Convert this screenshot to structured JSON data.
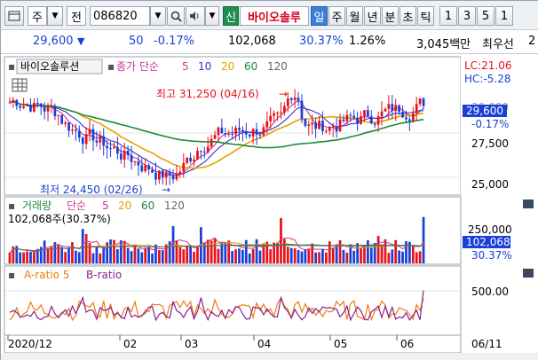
{
  "toolbar": {
    "market_label": "주",
    "type_label": "전",
    "code": "086820",
    "name": "바이오솔루",
    "new_badge": "신",
    "period_tabs": [
      {
        "label": "일",
        "active": true
      },
      {
        "label": "주",
        "active": false
      },
      {
        "label": "월",
        "active": false
      },
      {
        "label": "년",
        "active": false
      },
      {
        "label": "분",
        "active": false
      },
      {
        "label": "초",
        "active": false
      },
      {
        "label": "틱",
        "active": false
      }
    ],
    "interval_buttons": [
      "1",
      "3",
      "5",
      "1"
    ]
  },
  "quote": {
    "price": "29,600",
    "direction": "▼",
    "change": "50",
    "change_pct": "-0.17%",
    "volume": "102,068",
    "turnover_pct": "30.37%",
    "ratio": "1.26%",
    "amount": "3,045백만",
    "priority_label": "최우선",
    "priority_value": "2"
  },
  "price_panel": {
    "stock_name": "바이오솔루션",
    "ma_title": "종가 단순",
    "ma_periods": [
      "5",
      "10",
      "20",
      "60",
      "120"
    ],
    "ma_colors": [
      "#cc3399",
      "#3333cc",
      "#e8a000",
      "#1a8a3a",
      "#666666"
    ],
    "lc": "LC:21.06",
    "hc": "HC:-5.28",
    "high_annotation": "최고 31,250 (04/16)",
    "low_annotation": "최저 24,450 (02/26)",
    "current_price": "29,600",
    "current_change": "-0.17%",
    "y_ticks": [
      "27,500",
      "25,000"
    ]
  },
  "volume_panel": {
    "title": "거래량",
    "ma_title": "단순",
    "ma_periods": [
      "5",
      "20",
      "60",
      "120"
    ],
    "summary": "102,068주(30.37%)",
    "y_tick": "250,000",
    "current_volume": "102,068",
    "current_pct": "30.37%"
  },
  "ratio_panel": {
    "series_a": "A-ratio 5",
    "series_b": "B-ratio",
    "y_tick": "500.00"
  },
  "x_axis": {
    "labels": [
      "2020/12",
      "02",
      "03",
      "04",
      "05",
      "06"
    ],
    "end_date": "06/11"
  },
  "colors": {
    "up": "#e8101a",
    "down": "#1a3fd8",
    "a_ratio": "#f07a10",
    "b_ratio": "#8a1f8a"
  }
}
